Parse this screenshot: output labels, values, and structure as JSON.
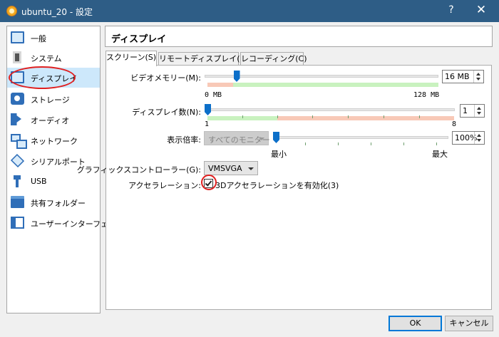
{
  "window": {
    "title": "ubuntu_20 - 設定",
    "help_label": "?",
    "close_label": "✕"
  },
  "sidebar": {
    "items": [
      {
        "label": "一般",
        "icon": "monitor-icon"
      },
      {
        "label": "システム",
        "icon": "chip-icon"
      },
      {
        "label": "ディスプレイ",
        "icon": "display-icon",
        "selected": true
      },
      {
        "label": "ストレージ",
        "icon": "disk-icon"
      },
      {
        "label": "オーディオ",
        "icon": "speaker-icon"
      },
      {
        "label": "ネットワーク",
        "icon": "network-icon"
      },
      {
        "label": "シリアルポート",
        "icon": "serial-port-icon"
      },
      {
        "label": "USB",
        "icon": "usb-icon"
      },
      {
        "label": "共有フォルダー",
        "icon": "folder-icon"
      },
      {
        "label": "ユーザーインターフェース",
        "icon": "user-interface-icon"
      }
    ]
  },
  "page": {
    "title": "ディスプレイ"
  },
  "tabs": [
    {
      "label": "スクリーン(S)",
      "active": true
    },
    {
      "label": "リモートディスプレイ(R)"
    },
    {
      "label": "レコーディング(C)"
    }
  ],
  "screen": {
    "video_memory": {
      "label": "ビデオメモリー(M):",
      "value_text": "16 MB",
      "min_label": "0 MB",
      "max_label": "128 MB",
      "value": 16,
      "max": 128
    },
    "monitor_count": {
      "label": "ディスプレイ数(N):",
      "value_text": "1",
      "min_label": "1",
      "max_label": "8",
      "value": 1,
      "max": 8
    },
    "scale_factor": {
      "label": "表示倍率:",
      "combo_value": "すべてのモニター",
      "value_text": "100%",
      "min_label": "最小",
      "max_label": "最大"
    },
    "graphics_controller": {
      "label": "グラフィックスコントローラー(G):",
      "value": "VMSVGA"
    },
    "acceleration": {
      "label": "アクセラレーション:",
      "checkbox_label": "3Dアクセラレーションを有効化(3)",
      "checked": true
    }
  },
  "buttons": {
    "ok": "OK",
    "cancel": "キャンセル"
  },
  "colors": {
    "titlebar": "#2e5d86",
    "accent": "#0c6fc9",
    "selection": "#cde8fb",
    "annotation": "#e02020"
  }
}
